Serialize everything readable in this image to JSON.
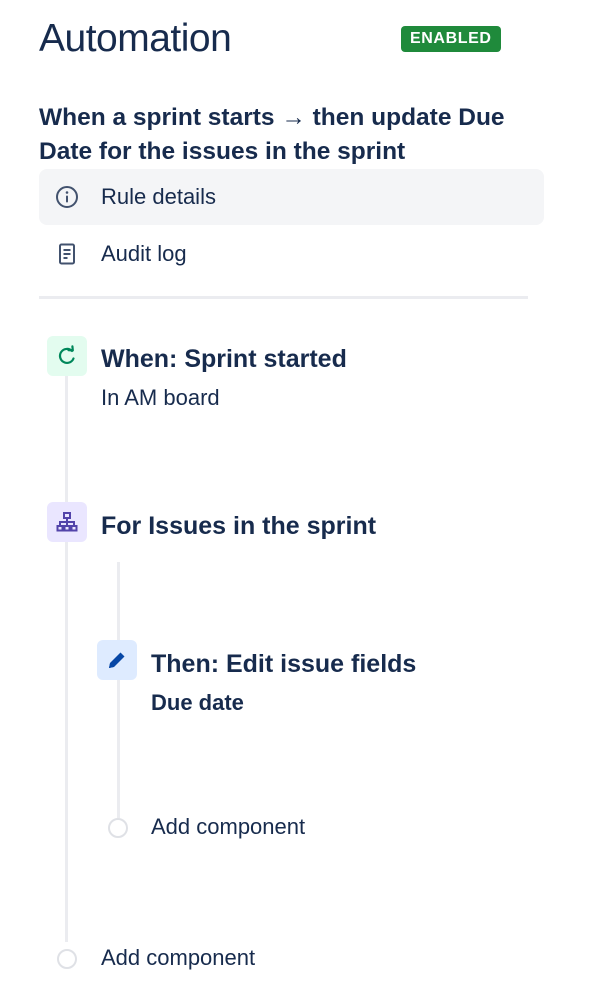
{
  "header": {
    "title": "Automation",
    "status_badge": "ENABLED"
  },
  "rule": {
    "name": "When a sprint starts → then update Due Date for the issues in the sprint"
  },
  "nav": {
    "items": [
      {
        "label": "Rule details",
        "icon": "info-icon",
        "active": true
      },
      {
        "label": "Audit log",
        "icon": "document-icon",
        "active": false
      }
    ]
  },
  "components": {
    "trigger": {
      "title": "When: Sprint started",
      "subtitle": "In AM board",
      "icon": "sprint-trigger-icon"
    },
    "branch": {
      "title": "For Issues in the sprint",
      "icon": "branch-icon"
    },
    "action": {
      "title": "Then: Edit issue fields",
      "subtitle": "Due date",
      "icon": "pencil-icon"
    },
    "add_component_nested": "Add component",
    "add_component_main": "Add component"
  },
  "colors": {
    "badge_green": "#1F8A3B",
    "text_primary": "#172B4D",
    "trigger_bg": "#E3FCEF",
    "branch_bg": "#EAE6FF",
    "action_bg": "#DEEBFF",
    "rail": "#EBECF0"
  }
}
